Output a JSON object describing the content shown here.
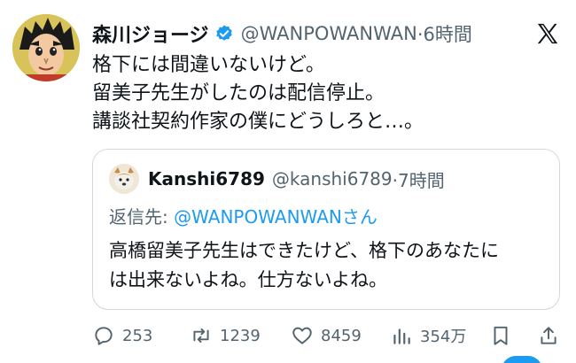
{
  "author": {
    "display_name": "森川ジョージ",
    "handle": "@WANPOWANWAN",
    "time": "·6時間",
    "avatar_icon": "avatar-manga-character-icon",
    "verified_icon": "verified-badge-icon"
  },
  "platform_icon": "x-logo-icon",
  "tweet_lines": [
    "格下には間違いないけど。",
    "留美子先生がしたのは配信停止。",
    "講談社契約作家の僕にどうしろと…。"
  ],
  "quote": {
    "display_name": "Kanshi6789",
    "handle": "@kanshi6789",
    "time": "·7時間",
    "avatar_icon": "avatar-dog-icon",
    "reply_prefix": "返信先: ",
    "reply_mention": "@WANPOWANWANさん",
    "text_lines": [
      "高橋留美子先生はできたけど、格下のあなたに",
      "は出来ないよね。仕方ないよね。"
    ]
  },
  "actions": {
    "replies": "253",
    "reposts": "1239",
    "likes": "8459",
    "views": "354万"
  },
  "colors": {
    "accent": "#1d9bf0",
    "muted": "#536471",
    "text": "#0f1419",
    "border": "#cfd9de"
  }
}
